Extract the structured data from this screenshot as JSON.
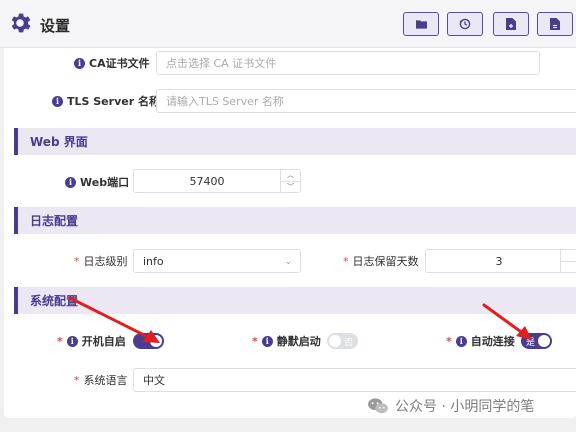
{
  "header": {
    "title": "设置",
    "toolbar": [
      {
        "name": "folder-button",
        "icon": "folder-icon"
      },
      {
        "name": "history-button",
        "icon": "history-icon"
      },
      {
        "name": "import-file-button",
        "icon": "file-import-icon"
      },
      {
        "name": "export-file-button",
        "icon": "file-export-icon"
      }
    ]
  },
  "tls": {
    "ca_label": "CA证书文件",
    "ca_placeholder": "点击选择 CA 证书文件",
    "server_label": "TLS Server 名称",
    "server_placeholder": "请输入TLS Server 名称"
  },
  "web": {
    "section_title": "Web 界面",
    "port_label": "Web端口",
    "port_value": "57400"
  },
  "log": {
    "section_title": "日志配置",
    "level_label": "日志级别",
    "level_value": "info",
    "retention_label": "日志保留天数",
    "retention_value": "3"
  },
  "system": {
    "section_title": "系统配置",
    "autostart_label": "开机自启",
    "autostart_on": true,
    "silent_label": "静默启动",
    "silent_on": false,
    "silent_text": "否",
    "autoconnect_label": "自动连接",
    "autoconnect_on": true,
    "autoconnect_text": "是",
    "language_label": "系统语言",
    "language_value": "中文"
  },
  "watermark": {
    "text": "公众号 · 小明同学的笔"
  },
  "colors": {
    "accent": "#4a3d8f",
    "section_bg": "#ebe8f4",
    "arrow": "#e02020"
  }
}
